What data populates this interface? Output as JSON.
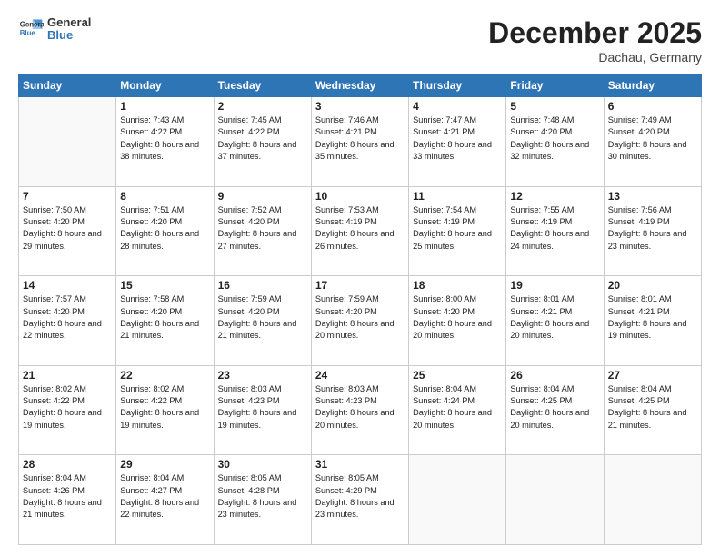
{
  "header": {
    "logo_line1": "General",
    "logo_line2": "Blue",
    "month": "December 2025",
    "location": "Dachau, Germany"
  },
  "weekdays": [
    "Sunday",
    "Monday",
    "Tuesday",
    "Wednesday",
    "Thursday",
    "Friday",
    "Saturday"
  ],
  "weeks": [
    [
      {
        "day": "",
        "empty": true
      },
      {
        "day": "1",
        "sunrise": "7:43 AM",
        "sunset": "4:22 PM",
        "daylight": "8 hours and 38 minutes."
      },
      {
        "day": "2",
        "sunrise": "7:45 AM",
        "sunset": "4:22 PM",
        "daylight": "8 hours and 37 minutes."
      },
      {
        "day": "3",
        "sunrise": "7:46 AM",
        "sunset": "4:21 PM",
        "daylight": "8 hours and 35 minutes."
      },
      {
        "day": "4",
        "sunrise": "7:47 AM",
        "sunset": "4:21 PM",
        "daylight": "8 hours and 33 minutes."
      },
      {
        "day": "5",
        "sunrise": "7:48 AM",
        "sunset": "4:20 PM",
        "daylight": "8 hours and 32 minutes."
      },
      {
        "day": "6",
        "sunrise": "7:49 AM",
        "sunset": "4:20 PM",
        "daylight": "8 hours and 30 minutes."
      }
    ],
    [
      {
        "day": "7",
        "sunrise": "7:50 AM",
        "sunset": "4:20 PM",
        "daylight": "8 hours and 29 minutes."
      },
      {
        "day": "8",
        "sunrise": "7:51 AM",
        "sunset": "4:20 PM",
        "daylight": "8 hours and 28 minutes."
      },
      {
        "day": "9",
        "sunrise": "7:52 AM",
        "sunset": "4:20 PM",
        "daylight": "8 hours and 27 minutes."
      },
      {
        "day": "10",
        "sunrise": "7:53 AM",
        "sunset": "4:19 PM",
        "daylight": "8 hours and 26 minutes."
      },
      {
        "day": "11",
        "sunrise": "7:54 AM",
        "sunset": "4:19 PM",
        "daylight": "8 hours and 25 minutes."
      },
      {
        "day": "12",
        "sunrise": "7:55 AM",
        "sunset": "4:19 PM",
        "daylight": "8 hours and 24 minutes."
      },
      {
        "day": "13",
        "sunrise": "7:56 AM",
        "sunset": "4:19 PM",
        "daylight": "8 hours and 23 minutes."
      }
    ],
    [
      {
        "day": "14",
        "sunrise": "7:57 AM",
        "sunset": "4:20 PM",
        "daylight": "8 hours and 22 minutes."
      },
      {
        "day": "15",
        "sunrise": "7:58 AM",
        "sunset": "4:20 PM",
        "daylight": "8 hours and 21 minutes."
      },
      {
        "day": "16",
        "sunrise": "7:59 AM",
        "sunset": "4:20 PM",
        "daylight": "8 hours and 21 minutes."
      },
      {
        "day": "17",
        "sunrise": "7:59 AM",
        "sunset": "4:20 PM",
        "daylight": "8 hours and 20 minutes."
      },
      {
        "day": "18",
        "sunrise": "8:00 AM",
        "sunset": "4:20 PM",
        "daylight": "8 hours and 20 minutes."
      },
      {
        "day": "19",
        "sunrise": "8:01 AM",
        "sunset": "4:21 PM",
        "daylight": "8 hours and 20 minutes."
      },
      {
        "day": "20",
        "sunrise": "8:01 AM",
        "sunset": "4:21 PM",
        "daylight": "8 hours and 19 minutes."
      }
    ],
    [
      {
        "day": "21",
        "sunrise": "8:02 AM",
        "sunset": "4:22 PM",
        "daylight": "8 hours and 19 minutes."
      },
      {
        "day": "22",
        "sunrise": "8:02 AM",
        "sunset": "4:22 PM",
        "daylight": "8 hours and 19 minutes."
      },
      {
        "day": "23",
        "sunrise": "8:03 AM",
        "sunset": "4:23 PM",
        "daylight": "8 hours and 19 minutes."
      },
      {
        "day": "24",
        "sunrise": "8:03 AM",
        "sunset": "4:23 PM",
        "daylight": "8 hours and 20 minutes."
      },
      {
        "day": "25",
        "sunrise": "8:04 AM",
        "sunset": "4:24 PM",
        "daylight": "8 hours and 20 minutes."
      },
      {
        "day": "26",
        "sunrise": "8:04 AM",
        "sunset": "4:25 PM",
        "daylight": "8 hours and 20 minutes."
      },
      {
        "day": "27",
        "sunrise": "8:04 AM",
        "sunset": "4:25 PM",
        "daylight": "8 hours and 21 minutes."
      }
    ],
    [
      {
        "day": "28",
        "sunrise": "8:04 AM",
        "sunset": "4:26 PM",
        "daylight": "8 hours and 21 minutes."
      },
      {
        "day": "29",
        "sunrise": "8:04 AM",
        "sunset": "4:27 PM",
        "daylight": "8 hours and 22 minutes."
      },
      {
        "day": "30",
        "sunrise": "8:05 AM",
        "sunset": "4:28 PM",
        "daylight": "8 hours and 23 minutes."
      },
      {
        "day": "31",
        "sunrise": "8:05 AM",
        "sunset": "4:29 PM",
        "daylight": "8 hours and 23 minutes."
      },
      {
        "day": "",
        "empty": true
      },
      {
        "day": "",
        "empty": true
      },
      {
        "day": "",
        "empty": true
      }
    ]
  ]
}
